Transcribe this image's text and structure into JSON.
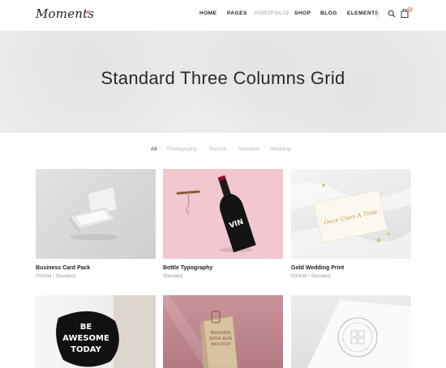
{
  "brand": {
    "logo_text": "Moments"
  },
  "nav": {
    "items": [
      {
        "label": "HOME",
        "active": false
      },
      {
        "label": "PAGES",
        "active": false
      },
      {
        "label": "PORTFOLIO",
        "active": true
      },
      {
        "label": "SHOP",
        "active": false
      },
      {
        "label": "BLOG",
        "active": false
      },
      {
        "label": "ELEMENTS",
        "active": false
      }
    ],
    "icons": [
      "search-icon",
      "shopping-bag-icon"
    ],
    "cart_count": "0"
  },
  "hero": {
    "title": "Standard Three Columns Grid"
  },
  "filters": [
    {
      "label": "All",
      "active": true
    },
    {
      "label": "Photography",
      "active": false
    },
    {
      "label": "Portrait",
      "active": false
    },
    {
      "label": "Standard",
      "active": false
    },
    {
      "label": "Wedding",
      "active": false
    }
  ],
  "portfolio": {
    "items": [
      {
        "title": "Business Card Pack",
        "category": "Portrait / Standard",
        "image": "business-card-box"
      },
      {
        "title": "Bottle Typography",
        "category": "Standard",
        "image": "wine-bottle-and-corkscrew"
      },
      {
        "title": "Gold Wedding Print",
        "category": "Portrait / Standard",
        "image": "wedding-card",
        "card_text": "Once Upon A Time"
      },
      {
        "title": "",
        "category": "",
        "image": "be-awesome-today-sign",
        "sign_lines": [
          "BE",
          "AWESOME",
          "TODAY"
        ]
      },
      {
        "title": "",
        "category": "",
        "image": "wooden-wine-box",
        "box_lines": [
          "WOODEN",
          "WINE BOX",
          "MOCKUP"
        ]
      },
      {
        "title": "",
        "category": "",
        "image": "stamp-paper"
      }
    ]
  },
  "colors": {
    "accent": "#e9b3a8",
    "text": "#222222",
    "muted": "#9a9a9a",
    "hero_bg": "#efefef"
  }
}
